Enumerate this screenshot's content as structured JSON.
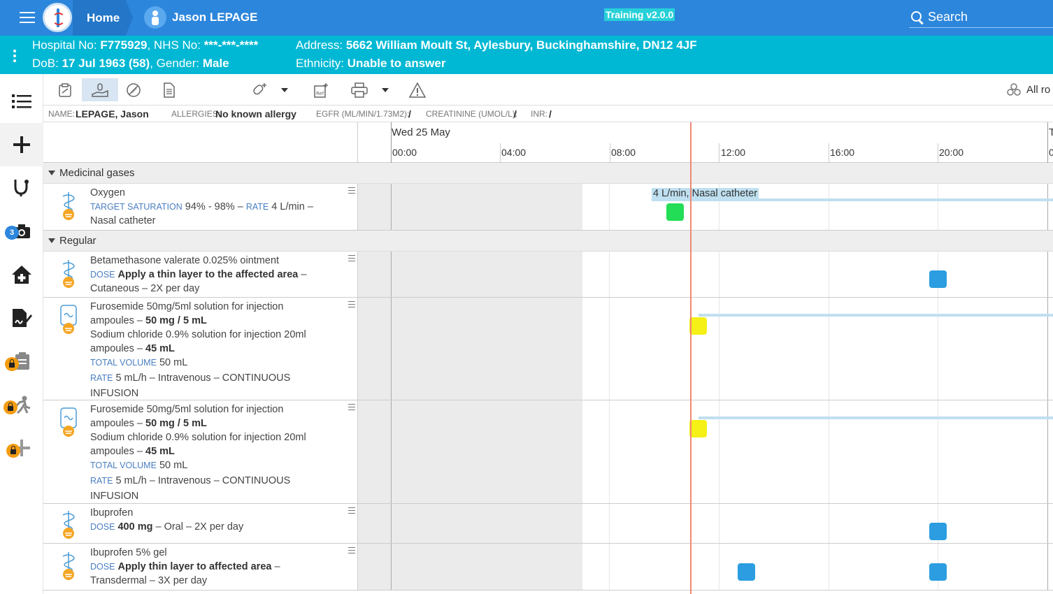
{
  "topbar": {
    "home_label": "Home",
    "patient_name": "Jason LEPAGE",
    "training_label": "Training v2.0.0",
    "search_label": "Search"
  },
  "banner": {
    "hospital_label": "Hospital No:",
    "hospital_no": "F775929",
    "nhs_label": ", NHS No:",
    "nhs_no": "***-***-****",
    "dob_label": "DoB:",
    "dob": "17 Jul 1963 (58)",
    "gender_label": ", Gender:",
    "gender": "Male",
    "address_label": "Address:",
    "address": "5662 William Moult St, Aylesbury, Buckinghamshire, DN12 4JF",
    "ethnicity_label": "Ethnicity:",
    "ethnicity": "Unable to answer"
  },
  "sidebar": {
    "camera_badge": "3"
  },
  "toolbar": {
    "all_routes_label": "All ro"
  },
  "info": {
    "name_label": "NAME:",
    "name": "LEPAGE, Jason",
    "allergies_label": "ALLERGIES:",
    "allergies": "No known allergy",
    "egfr_label": "EGFR (ML/MIN/1.73M2):",
    "egfr": "/",
    "creatinine_label": "CREATININE (UMOL/L):",
    "creatinine": "/",
    "inr_label": "INR:",
    "inr": "/"
  },
  "timeline": {
    "date": "Wed 25 May",
    "next_date": "T",
    "ticks": [
      "00:00",
      "04:00",
      "08:00",
      "12:00",
      "16:00",
      "20:00",
      "0"
    ]
  },
  "sections": {
    "gases": "Medicinal gases",
    "regular": "Regular"
  },
  "meds": {
    "oxygen": {
      "name": "Oxygen",
      "target_label": "TARGET SATURATION",
      "target": "94% - 98% –",
      "rate_label": "RATE",
      "rate": "4 L/min –",
      "route": "Nasal catheter",
      "annotation": "4 L/min, Nasal catheter"
    },
    "betamethasone": {
      "name": "Betamethasone valerate 0.025% ointment",
      "dose_label": "DOSE",
      "dose": "Apply a thin layer to the affected area",
      "dose_suffix": " –",
      "route": "Cutaneous – 2X per day"
    },
    "furosemide1": {
      "line1": "Furosemide 50mg/5ml solution for injection",
      "line2_prefix": "ampoules – ",
      "line2_bold": "50 mg / 5 mL",
      "line3": "Sodium chloride 0.9% solution for injection 20ml",
      "line4_prefix": "ampoules – ",
      "line4_bold": "45 mL",
      "total_label": "TOTAL VOLUME",
      "total": "50 mL",
      "rate_label": "RATE",
      "rate": "5 mL/h – Intravenous – CONTINUOUS",
      "rate2": "INFUSION"
    },
    "furosemide2": {
      "line1": "Furosemide 50mg/5ml solution for injection",
      "line2_prefix": "ampoules – ",
      "line2_bold": "50 mg / 5 mL",
      "line3": "Sodium chloride 0.9% solution for injection 20ml",
      "line4_prefix": "ampoules – ",
      "line4_bold": "45 mL",
      "total_label": "TOTAL VOLUME",
      "total": "50 mL",
      "rate_label": "RATE",
      "rate": "5 mL/h – Intravenous – CONTINUOUS",
      "rate2": "INFUSION"
    },
    "ibuprofen": {
      "name": "Ibuprofen",
      "dose_label": "DOSE",
      "dose": "400 mg",
      "rest": " – Oral – 2X per day"
    },
    "ibugel": {
      "name": "Ibuprofen 5% gel",
      "dose_label": "DOSE",
      "dose": "Apply thin layer to affected area",
      "dose_suffix": " –",
      "route": "Transdermal – 3X per day"
    }
  },
  "colors": {
    "topbar": "#2c86dc",
    "banner": "#00b8d4",
    "given": "#22dd55",
    "due": "#f5f015",
    "scheduled": "#2b9de0",
    "now_line": "#ee8877"
  }
}
